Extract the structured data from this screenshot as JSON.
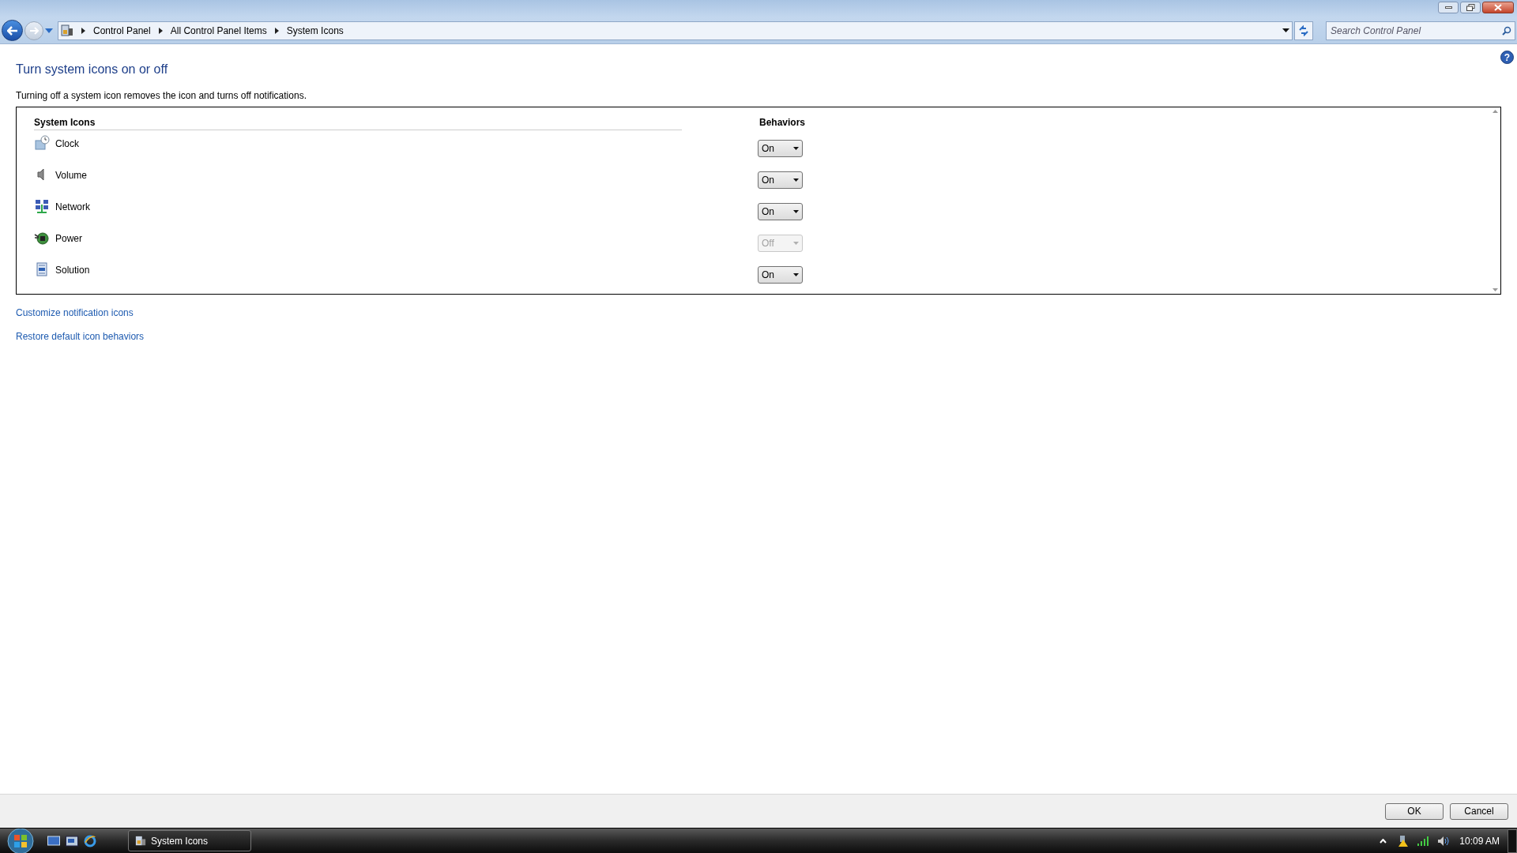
{
  "address_bar": {
    "breadcrumbs": [
      "Control Panel",
      "All Control Panel Items",
      "System Icons"
    ]
  },
  "search": {
    "placeholder": "Search Control Panel"
  },
  "help": {
    "label": "?"
  },
  "heading": "Turn system icons on or off",
  "description": "Turning off a system icon removes the icon and turns off notifications.",
  "table": {
    "columns": [
      "System Icons",
      "Behaviors"
    ],
    "rows": [
      {
        "name": "Clock",
        "kind": "clock",
        "value": "On",
        "disabled": false
      },
      {
        "name": "Volume",
        "kind": "volume",
        "value": "On",
        "disabled": false
      },
      {
        "name": "Network",
        "kind": "network",
        "value": "On",
        "disabled": false
      },
      {
        "name": "Power",
        "kind": "power",
        "value": "Off",
        "disabled": true
      },
      {
        "name": "Solution",
        "kind": "solution",
        "value": "On",
        "disabled": false
      }
    ]
  },
  "links": [
    "Customize notification icons",
    "Restore default icon behaviors"
  ],
  "buttons": [
    "OK",
    "Cancel"
  ],
  "taskbar": {
    "tasks": [
      {
        "label": "System Icons",
        "selected": true
      }
    ],
    "clock": "10:09 AM"
  }
}
